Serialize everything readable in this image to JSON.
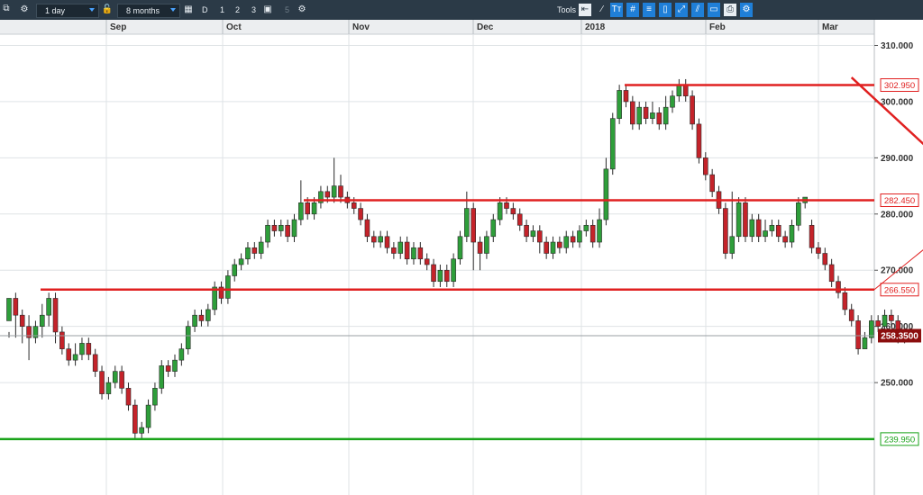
{
  "toolbar": {
    "interval_label": "1 day",
    "range_label": "8 months",
    "chart_type_letter": "D",
    "layouts": [
      "1",
      "2",
      "3"
    ],
    "layout_extra": "5",
    "tools_label": "Tools",
    "colors": {
      "bg": "#2b3a47",
      "accent": "#1f7fd8"
    }
  },
  "chart_data": {
    "type": "candlestick",
    "x_ticks": [
      "Sep",
      "Oct",
      "Nov",
      "Dec",
      "2018",
      "Feb",
      "Mar"
    ],
    "y_ticks": [
      "310.000",
      "300.000",
      "290.000",
      "280.000",
      "270.000",
      "260.000",
      "250.000"
    ],
    "ylim": [
      230,
      312
    ],
    "grid": true,
    "colors": {
      "up": "#2e9e3a",
      "down": "#c4232a",
      "line_red": "#e02020",
      "line_green": "#1aa31a",
      "current": "#8b0e0e"
    },
    "price_levels": [
      {
        "label": "302.950",
        "value": 302.95,
        "color": "#e02020"
      },
      {
        "label": "282.450",
        "value": 282.45,
        "color": "#e02020"
      },
      {
        "label": "266.550",
        "value": 266.55,
        "color": "#e02020"
      },
      {
        "label": "239.950",
        "value": 239.95,
        "color": "#1aa31a"
      }
    ],
    "current_price": {
      "label": "258.3500",
      "value": 258.35
    },
    "trendline": {
      "from": [
        127,
        304.3
      ],
      "to": [
        147,
        282.45
      ],
      "extension_to": [
        160,
        266.55
      ]
    },
    "candles": [
      [
        261,
        265,
        259,
        258
      ],
      [
        265,
        262,
        266,
        258
      ],
      [
        262,
        260,
        263,
        257
      ],
      [
        260,
        258,
        262,
        254
      ],
      [
        258,
        260,
        261,
        257
      ],
      [
        260,
        262,
        264,
        258
      ],
      [
        262,
        265,
        266,
        260
      ],
      [
        265,
        259,
        266,
        257
      ],
      [
        259,
        256,
        260,
        255
      ],
      [
        256,
        254,
        257,
        253
      ],
      [
        254,
        255,
        257,
        253
      ],
      [
        255,
        257,
        258,
        254
      ],
      [
        257,
        255,
        258,
        254
      ],
      [
        255,
        252,
        256,
        251
      ],
      [
        252,
        248,
        253,
        247
      ],
      [
        248,
        250,
        251,
        247
      ],
      [
        250,
        252,
        253,
        249
      ],
      [
        252,
        249,
        253,
        248
      ],
      [
        249,
        246,
        250,
        245
      ],
      [
        246,
        241,
        247,
        240
      ],
      [
        241,
        242,
        243,
        240
      ],
      [
        242,
        246,
        247,
        241
      ],
      [
        246,
        249,
        250,
        245
      ],
      [
        249,
        253,
        254,
        248
      ],
      [
        253,
        252,
        254,
        251
      ],
      [
        252,
        254,
        255,
        251
      ],
      [
        254,
        256,
        257,
        253
      ],
      [
        256,
        260,
        261,
        255
      ],
      [
        260,
        262,
        263,
        259
      ],
      [
        262,
        261,
        263,
        260
      ],
      [
        261,
        263,
        264,
        260
      ],
      [
        263,
        267,
        268,
        262
      ],
      [
        267,
        265,
        268,
        264
      ],
      [
        265,
        269,
        270,
        264
      ],
      [
        269,
        271,
        272,
        268
      ],
      [
        271,
        272,
        273,
        270
      ],
      [
        272,
        274,
        275,
        271
      ],
      [
        274,
        273,
        275,
        272
      ],
      [
        273,
        275,
        276,
        272
      ],
      [
        275,
        278,
        279,
        274
      ],
      [
        278,
        277,
        279,
        276
      ],
      [
        277,
        278,
        279,
        276
      ],
      [
        278,
        276,
        279,
        275
      ],
      [
        276,
        279,
        280,
        275
      ],
      [
        279,
        282,
        286,
        278
      ],
      [
        282,
        280,
        283,
        279
      ],
      [
        280,
        282,
        283,
        279
      ],
      [
        282,
        284,
        285,
        281
      ],
      [
        284,
        283,
        285,
        282
      ],
      [
        283,
        285,
        290,
        282
      ],
      [
        285,
        283,
        287,
        282
      ],
      [
        283,
        282,
        284,
        281
      ],
      [
        282,
        281,
        283,
        280
      ],
      [
        281,
        279,
        282,
        278
      ],
      [
        279,
        276,
        280,
        275
      ],
      [
        276,
        275,
        277,
        274
      ],
      [
        275,
        276,
        277,
        274
      ],
      [
        276,
        274,
        277,
        273
      ],
      [
        274,
        273,
        275,
        272
      ],
      [
        273,
        275,
        276,
        272
      ],
      [
        275,
        272,
        276,
        271
      ],
      [
        272,
        274,
        275,
        271
      ],
      [
        274,
        272,
        275,
        271
      ],
      [
        272,
        271,
        273,
        270
      ],
      [
        271,
        268,
        272,
        267
      ],
      [
        268,
        270,
        271,
        267
      ],
      [
        270,
        268,
        271,
        267
      ],
      [
        268,
        272,
        273,
        267
      ],
      [
        272,
        276,
        277,
        271
      ],
      [
        276,
        281,
        284,
        275
      ],
      [
        281,
        275,
        282,
        270
      ],
      [
        275,
        273,
        276,
        270
      ],
      [
        273,
        276,
        277,
        272
      ],
      [
        276,
        279,
        280,
        275
      ],
      [
        279,
        282,
        283,
        278
      ],
      [
        282,
        281,
        283,
        280
      ],
      [
        281,
        280,
        282,
        279
      ],
      [
        280,
        278,
        281,
        277
      ],
      [
        278,
        276,
        279,
        275
      ],
      [
        276,
        277,
        278,
        275
      ],
      [
        277,
        275,
        278,
        273
      ],
      [
        275,
        273,
        276,
        272
      ],
      [
        273,
        275,
        276,
        272
      ],
      [
        275,
        274,
        276,
        273
      ],
      [
        274,
        276,
        277,
        273
      ],
      [
        276,
        275,
        277,
        274
      ],
      [
        275,
        277,
        278,
        274
      ],
      [
        277,
        278,
        279,
        276
      ],
      [
        278,
        275,
        279,
        274
      ],
      [
        275,
        279,
        281,
        274
      ],
      [
        279,
        288,
        290,
        278
      ],
      [
        288,
        297,
        298,
        287
      ],
      [
        297,
        302,
        303,
        296
      ],
      [
        302,
        300,
        303,
        299
      ],
      [
        300,
        296,
        301,
        295
      ],
      [
        296,
        299,
        300,
        295
      ],
      [
        299,
        297,
        300,
        296
      ],
      [
        297,
        298,
        300,
        296
      ],
      [
        298,
        296,
        299,
        295
      ],
      [
        296,
        299,
        301,
        295
      ],
      [
        299,
        301,
        302,
        298
      ],
      [
        301,
        303,
        304,
        300
      ],
      [
        303,
        301,
        304,
        300
      ],
      [
        301,
        296,
        302,
        295
      ],
      [
        296,
        290,
        297,
        289
      ],
      [
        290,
        287,
        291,
        286
      ],
      [
        287,
        284,
        288,
        283
      ],
      [
        284,
        281,
        285,
        280
      ],
      [
        281,
        273,
        282,
        272
      ],
      [
        273,
        276,
        284,
        272
      ],
      [
        276,
        282,
        283,
        275
      ],
      [
        282,
        276,
        283,
        275
      ],
      [
        276,
        279,
        280,
        275
      ],
      [
        279,
        276,
        280,
        275
      ],
      [
        276,
        277,
        279,
        275
      ],
      [
        277,
        278,
        279,
        276
      ],
      [
        278,
        276,
        279,
        275
      ],
      [
        276,
        275,
        277,
        274
      ],
      [
        275,
        278,
        279,
        274
      ],
      [
        278,
        282,
        283,
        277
      ],
      [
        282,
        283,
        283,
        281
      ],
      [
        278,
        274,
        279,
        273
      ],
      [
        274,
        273,
        275,
        272
      ],
      [
        273,
        271,
        274,
        270
      ],
      [
        271,
        268,
        272,
        267
      ],
      [
        268,
        266,
        269,
        265
      ],
      [
        266,
        263,
        267,
        262
      ],
      [
        263,
        261,
        264,
        260
      ],
      [
        261,
        256,
        262,
        255
      ],
      [
        256,
        258,
        259,
        257
      ],
      [
        258,
        261,
        262,
        257
      ],
      [
        261,
        260,
        262,
        259
      ],
      [
        260,
        262,
        263,
        259
      ],
      [
        262,
        261,
        263,
        260
      ],
      [
        261,
        258,
        262,
        257
      ],
      [
        258,
        258.35,
        259,
        257
      ]
    ]
  }
}
